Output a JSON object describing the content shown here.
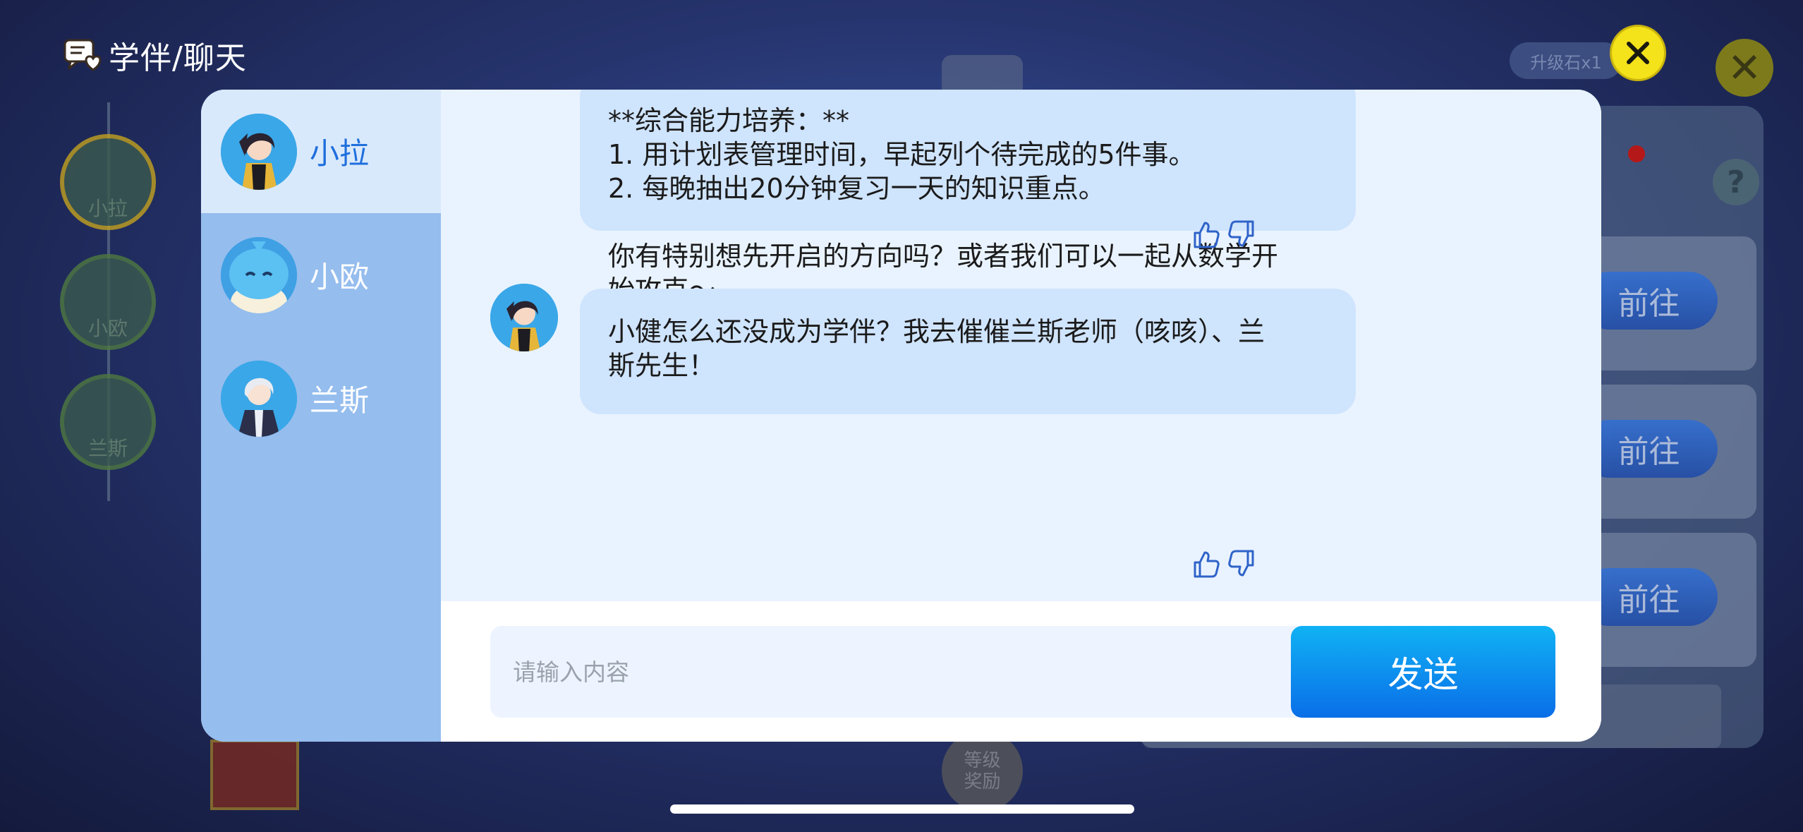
{
  "header": {
    "title": "学伴/聊天",
    "icon": "chat-heart-icon"
  },
  "close_icon": "close-x-icon",
  "characters": [
    {
      "name": "小拉",
      "active": true
    },
    {
      "name": "小欧",
      "active": false
    },
    {
      "name": "兰斯",
      "active": false
    }
  ],
  "messages": [
    {
      "lines": "**综合能力培养：**\n1. 用计划表管理时间，早起列个待完成的5件事。\n2. 每晚抽出20分钟复习一天的知识重点。\n\n你有特别想先开启的方向吗？或者我们可以一起从数学开\n始攻克～"
    },
    {
      "lines": "小健怎么还没成为学伴？我去催催兰斯老师（咳咳）、兰\n斯先生！"
    }
  ],
  "input": {
    "placeholder": "请输入内容",
    "value": ""
  },
  "send_label": "发送",
  "background": {
    "go_labels": [
      "前往",
      "前往",
      "前往"
    ],
    "sidebar_names": [
      "小拉",
      "小欧",
      "兰斯"
    ],
    "level_reward": "等级\n奖励",
    "upgrade_chip": "升级石x1",
    "help": "?"
  },
  "colors": {
    "accent": "#1f6fdc",
    "close_yellow": "#f4e21a",
    "bubble": "#cfe4fd",
    "sidebar": "#95bdee"
  }
}
